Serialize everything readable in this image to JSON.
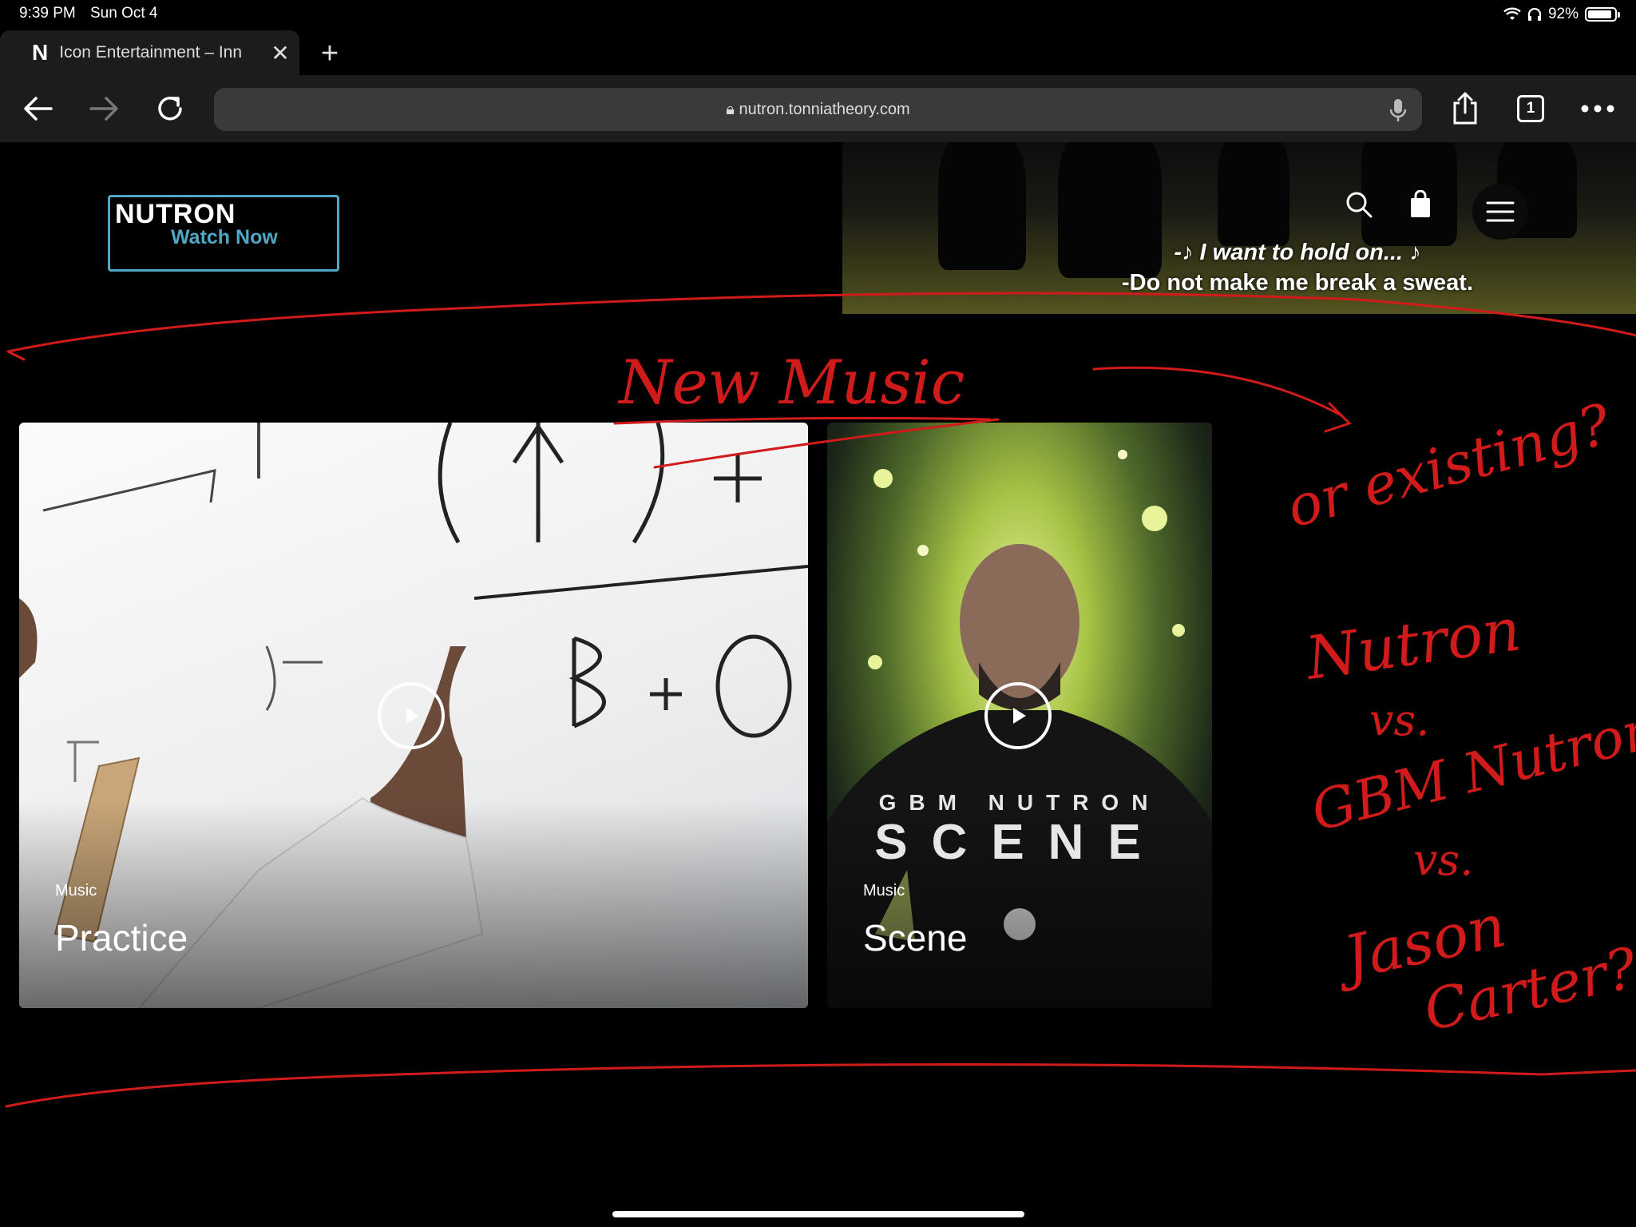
{
  "status_bar": {
    "time": "9:39 PM",
    "date": "Sun Oct 4",
    "battery": "92%",
    "battery_level": 0.92
  },
  "browser": {
    "tab": {
      "favicon": "N",
      "title": "Icon Entertainment – Inn",
      "close": "✕"
    },
    "new_tab": "+",
    "url": "nutron.tonniatheory.com",
    "tab_count": "1",
    "accent": "#1c1c1e"
  },
  "site": {
    "logo": {
      "name": "NUTRON",
      "cta": "Watch Now",
      "accent": "#4ea7c4"
    },
    "hero": {
      "lyric_line_1": "-♪ I want to hold on... ♪",
      "lyric_line_2": "-Do not make me break a sweat."
    },
    "icons": [
      "search-icon",
      "shopping-bag-icon",
      "hamburger-menu-icon"
    ]
  },
  "cards": [
    {
      "category": "Music",
      "title": "Practice"
    },
    {
      "category": "Music",
      "title": "Scene",
      "poster_subtitle": "GBM NUTRON",
      "poster_title": "SCENE"
    }
  ],
  "annotations": {
    "color": "#d11b1b",
    "heading": "New Music",
    "question": "or existing?",
    "line1": "Nutron",
    "vs1": "vs.",
    "line2": "GBM Nutron",
    "vs2": "vs.",
    "line3": "Jason",
    "line4": "Carter?"
  }
}
